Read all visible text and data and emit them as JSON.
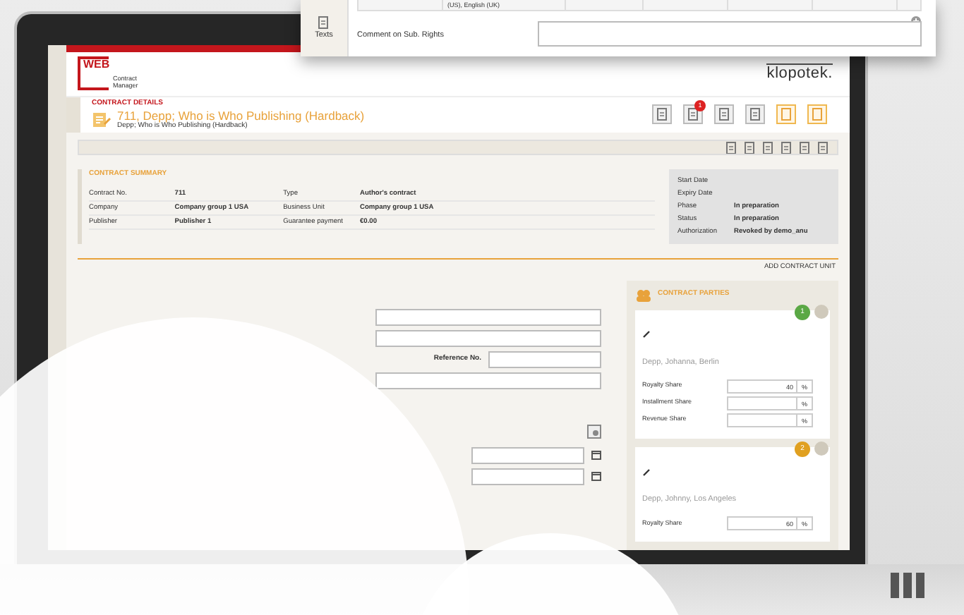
{
  "popup": {
    "cell_text": "(US), English (UK)",
    "side_tab": "Texts",
    "comment_label": "Comment on Sub. Rights"
  },
  "app": {
    "logo_word": "WEB",
    "logo_sub": "Contract Manager",
    "brand": "klopotek."
  },
  "details": {
    "heading": "CONTRACT DETAILS",
    "title": "711, Depp; Who is Who Publishing (Hardback)",
    "subtitle": "Depp; Who is Who Publishing (Hardback)",
    "buttons": [
      {
        "kind": "plain"
      },
      {
        "kind": "plain",
        "badge": "1"
      },
      {
        "kind": "plain"
      },
      {
        "kind": "plain"
      },
      {
        "kind": "accent"
      },
      {
        "kind": "accent"
      }
    ]
  },
  "summary": {
    "heading": "CONTRACT SUMMARY",
    "rows": [
      [
        "Contract No.",
        "711",
        "Type",
        "Author's contract"
      ],
      [
        "Company",
        "Company group 1 USA",
        "Business Unit",
        "Company group 1 USA"
      ],
      [
        "Publisher",
        "Publisher 1",
        "Guarantee payment",
        "€0.00"
      ]
    ],
    "status": [
      {
        "label": "Start Date"
      },
      {
        "label": "Expiry Date"
      },
      {
        "label": "Phase",
        "value": "In preparation"
      },
      {
        "label": "Status",
        "value": "In preparation"
      },
      {
        "label": "Authorization",
        "value": "Revoked by demo_anu"
      }
    ]
  },
  "add_unit": "ADD CONTRACT UNIT",
  "subject": {
    "reference_label": "Reference No."
  },
  "parties": {
    "heading": "CONTRACT PARTIES",
    "items": [
      {
        "number": "1",
        "color": "#5aa845",
        "name": "Depp, Johanna, Berlin",
        "shares": [
          {
            "label": "Royalty Share",
            "value": "40",
            "unit": "%"
          },
          {
            "label": "Installment Share",
            "unit": "%"
          },
          {
            "label": "Revenue Share",
            "unit": "%"
          }
        ]
      },
      {
        "number": "2",
        "color": "#e0a020",
        "name": "Depp, Johnny, Los Angeles",
        "shares": [
          {
            "label": "Royalty Share",
            "value": "60",
            "unit": "%"
          }
        ]
      }
    ]
  }
}
